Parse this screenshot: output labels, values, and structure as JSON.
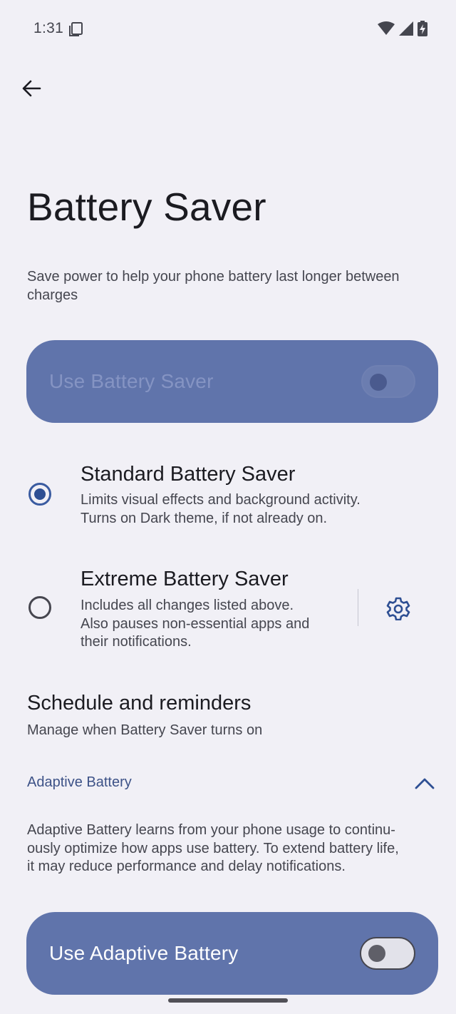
{
  "status_bar": {
    "time": "1:31",
    "icons": [
      "notification-icon",
      "wifi-icon",
      "cell-signal-icon",
      "battery-charging-icon"
    ]
  },
  "header": {
    "title": "Battery Saver",
    "description": "Save power to help your phone battery last longer between charges"
  },
  "battery_saver_switch": {
    "label": "Use Battery Saver",
    "checked": false,
    "enabled": false
  },
  "modes": [
    {
      "title": "Standard Battery Saver",
      "summary_lines": [
        "Limits visual effects and background activity.",
        "Turns on Dark theme, if not already on."
      ],
      "selected": true
    },
    {
      "title": "Extreme Battery Saver",
      "summary_lines": [
        "Includes all changes listed above.",
        "Also pauses non-essential apps and",
        "their notifications."
      ],
      "selected": false
    }
  ],
  "schedule": {
    "title": "Schedule and reminders",
    "summary": "Manage when Battery Saver turns on"
  },
  "adaptive": {
    "header": "Adaptive Battery",
    "description_lines": [
      "Adaptive Battery learns from your phone usage to continu-",
      "ously optimize how apps use battery. To extend battery life,",
      "it may reduce performance and delay notifications."
    ],
    "switch_label": "Use Adaptive Battery",
    "switch_checked": false
  },
  "colors": {
    "background": "#f1f0f6",
    "switch_bar": "#6074ab",
    "accent": "#3a5ba0"
  }
}
